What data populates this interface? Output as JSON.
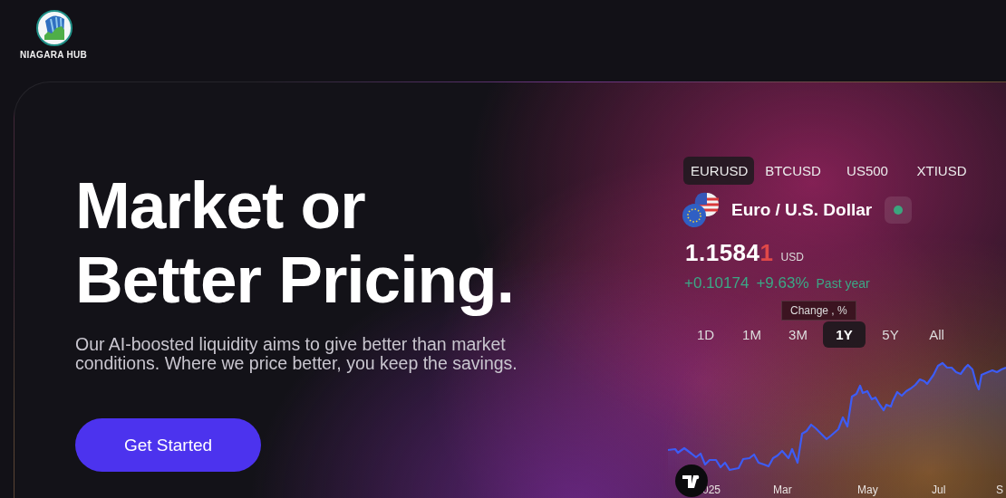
{
  "brand": {
    "name": "NIAGARA HUB"
  },
  "hero": {
    "heading_lines": [
      "Market or",
      "Better Pricing."
    ],
    "text": "Our AI-boosted liquidity aims to give better than market conditions. Where we price better, you keep the savings.",
    "button": "Get Started"
  },
  "widget": {
    "symbols": [
      {
        "label": "EURUSD",
        "selected": true
      },
      {
        "label": "BTCUSD",
        "selected": false
      },
      {
        "label": "US500",
        "selected": false
      },
      {
        "label": "XTIUSD",
        "selected": false
      }
    ],
    "instrument": {
      "name": "Euro / U.S. Dollar",
      "live": true
    },
    "price": {
      "value": "1.1584",
      "last_digit": "1",
      "currency": "USD"
    },
    "change": {
      "absolute": "+0.10174",
      "percent": "+9.63%",
      "period": "Past year"
    },
    "tooltip": "Change , %",
    "ranges": [
      {
        "label": "1D",
        "selected": false
      },
      {
        "label": "1M",
        "selected": false
      },
      {
        "label": "3M",
        "selected": false
      },
      {
        "label": "1Y",
        "selected": true
      },
      {
        "label": "5Y",
        "selected": false
      },
      {
        "label": "All",
        "selected": false
      }
    ],
    "chart_axis_labels": [
      "025",
      "Mar",
      "May",
      "Jul",
      "S"
    ]
  }
}
